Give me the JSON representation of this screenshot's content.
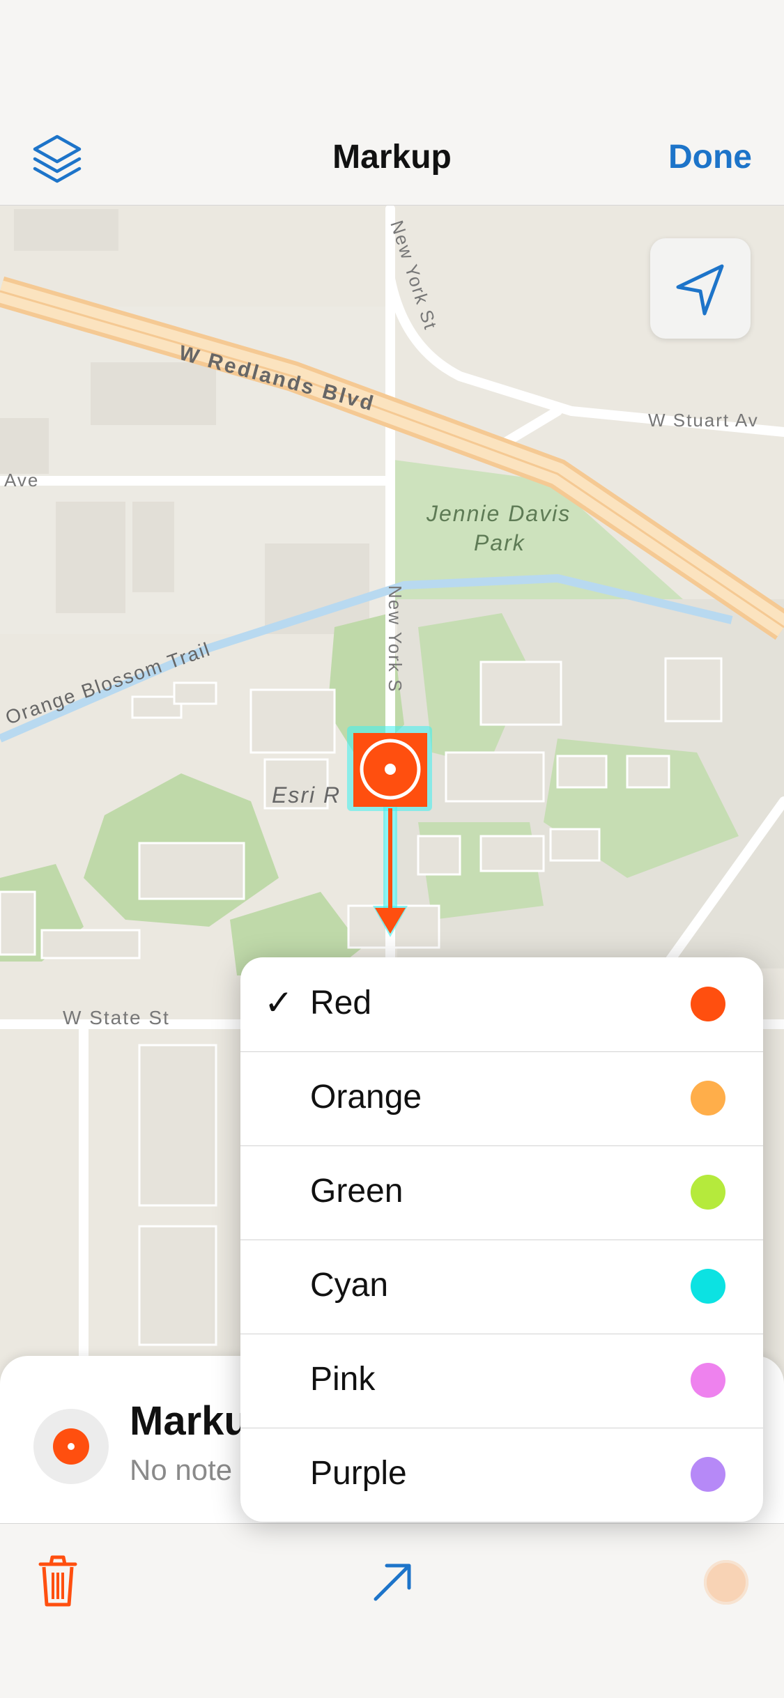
{
  "nav": {
    "title": "Markup",
    "done_label": "Done",
    "layers_icon": "layers-icon"
  },
  "map": {
    "labels": {
      "road_redlands": "W Redlands Blvd",
      "road_newyork_top": "New York St",
      "road_stuart": "W Stuart Av",
      "road_ave": "Ave",
      "park_line1": "Jennie Davis",
      "park_line2": "Park",
      "road_newyork_mid": "New York S",
      "trail": "Orange Blossom Trail",
      "campus": "Esri R",
      "road_state": "W State St"
    },
    "locate_icon": "location-arrow-icon"
  },
  "card": {
    "title": "Marku",
    "subtitle": "No note"
  },
  "color_menu": {
    "items": [
      {
        "label": "Red",
        "color": "#ff4f0f",
        "selected": true,
        "check": "✓"
      },
      {
        "label": "Orange",
        "color": "#ffae4a",
        "selected": false,
        "check": ""
      },
      {
        "label": "Green",
        "color": "#b5ea3c",
        "selected": false,
        "check": ""
      },
      {
        "label": "Cyan",
        "color": "#0ce2e2",
        "selected": false,
        "check": ""
      },
      {
        "label": "Pink",
        "color": "#ee82ee",
        "selected": false,
        "check": ""
      },
      {
        "label": "Purple",
        "color": "#b689f7",
        "selected": false,
        "check": ""
      }
    ]
  },
  "toolbar": {
    "delete_icon": "trash-icon",
    "move_icon": "arrow-up-right-icon",
    "color_icon": "color-circle-icon"
  },
  "colors": {
    "accent": "#1d74c9",
    "markup": "#ff4f0f",
    "highlight": "#3ef0f0"
  }
}
